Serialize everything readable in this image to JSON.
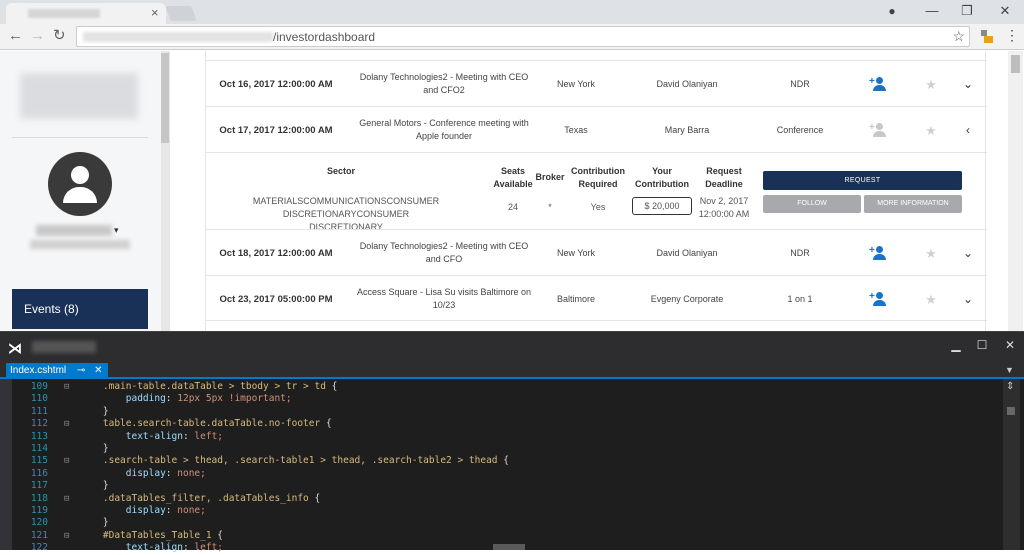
{
  "browser": {
    "tab_close": "×",
    "url_path": "/investordashboard",
    "back": "←",
    "forward": "→",
    "reload": "↻",
    "bookmark": "☆",
    "menu": "⋮",
    "profile": "●",
    "minimize": "—",
    "restore": "❐",
    "close": "✕"
  },
  "sidebar": {
    "events_label": "Events (8)",
    "caret": "▾"
  },
  "events": [
    {
      "date": "Oct 16, 2017 12:00:00 AM",
      "title": "Dolany Technologies2 - Meeting with CEO and CFO2",
      "city": "New York",
      "person": "David Olaniyan",
      "type": "NDR",
      "chevron": "⌄",
      "active": true
    },
    {
      "date": "Oct 17, 2017 12:00:00 AM",
      "title": "General Motors - Conference meeting with Apple founder",
      "city": "Texas",
      "person": "Mary Barra",
      "type": "Conference",
      "chevron": "‹",
      "active": false
    },
    {
      "date": "Oct 18, 2017 12:00:00 AM",
      "title": "Dolany Technologies2 - Meeting with CEO and CFO",
      "city": "New York",
      "person": "David Olaniyan",
      "type": "NDR",
      "chevron": "⌄",
      "active": true
    },
    {
      "date": "Oct 23, 2017 05:00:00 PM",
      "title": "Access Square - Lisa Su visits Baltimore on 10/23",
      "city": "Baltimore",
      "person": "Evgeny Corporate",
      "type": "1 on 1",
      "chevron": "⌄",
      "active": true
    }
  ],
  "detail": {
    "headers": {
      "sector": "Sector",
      "seats": "Seats Available",
      "broker": "Broker",
      "contribution_required": "Contribution Required",
      "your_contribution": "Your Contribution",
      "request_deadline": "Request Deadline"
    },
    "sector": "MATERIALSCOMMUNICATIONSCONSUMER DISCRETIONARYCONSUMER DISCRETIONARY",
    "seats": "24",
    "broker": "*",
    "contribution_required": "Yes",
    "your_contribution": "$ 20,000",
    "request_deadline": "Nov 2, 2017 12:00:00 AM",
    "request_button": "REQUEST",
    "follow_button": "FOLLOW",
    "more_button": "MORE INFORMATION"
  },
  "colors": {
    "navy": "#1a3157",
    "icon_active": "#1a73c8",
    "icon_inactive": "#c8c8c8",
    "selector": "#d7ba7d",
    "property": "#9cdcfe",
    "value": "#ce9178",
    "plain": "#dcdcdc"
  },
  "vs": {
    "logo": "⋊",
    "tab_name": "Index.cshtml",
    "tab_pin": "⊸",
    "tab_close": "✕",
    "tab_menu": "▼",
    "split": "⇕",
    "window_min": "▁",
    "window_max": "☐",
    "window_close": "✕",
    "lines": [
      {
        "n": "109",
        "fold": "⊟",
        "kind": "sel",
        "text": "    .main-table.dataTable > tbody > tr > td {"
      },
      {
        "n": "110",
        "fold": "",
        "kind": "prop",
        "prop": "        padding",
        "val": " 12px 5px !important;"
      },
      {
        "n": "111",
        "fold": "",
        "kind": "plain",
        "text": "    }"
      },
      {
        "n": "112",
        "fold": "⊟",
        "kind": "sel",
        "text": "    table.search-table.dataTable.no-footer {"
      },
      {
        "n": "113",
        "fold": "",
        "kind": "prop",
        "prop": "        text-align",
        "val": " left;"
      },
      {
        "n": "114",
        "fold": "",
        "kind": "plain",
        "text": "    }"
      },
      {
        "n": "115",
        "fold": "⊟",
        "kind": "sel",
        "text": "    .search-table > thead, .search-table1 > thead, .search-table2 > thead {"
      },
      {
        "n": "116",
        "fold": "",
        "kind": "prop",
        "prop": "        display",
        "val": " none;"
      },
      {
        "n": "117",
        "fold": "",
        "kind": "plain",
        "text": "    }"
      },
      {
        "n": "118",
        "fold": "⊟",
        "kind": "sel",
        "text": "    .dataTables_filter, .dataTables_info {"
      },
      {
        "n": "119",
        "fold": "",
        "kind": "prop",
        "prop": "        display",
        "val": " none;"
      },
      {
        "n": "120",
        "fold": "",
        "kind": "plain",
        "text": "    }"
      },
      {
        "n": "121",
        "fold": "⊟",
        "kind": "sel",
        "text": "    #DataTables_Table_1 {"
      },
      {
        "n": "122",
        "fold": "",
        "kind": "prop",
        "prop": "        text-align",
        "val": " left;"
      }
    ]
  }
}
